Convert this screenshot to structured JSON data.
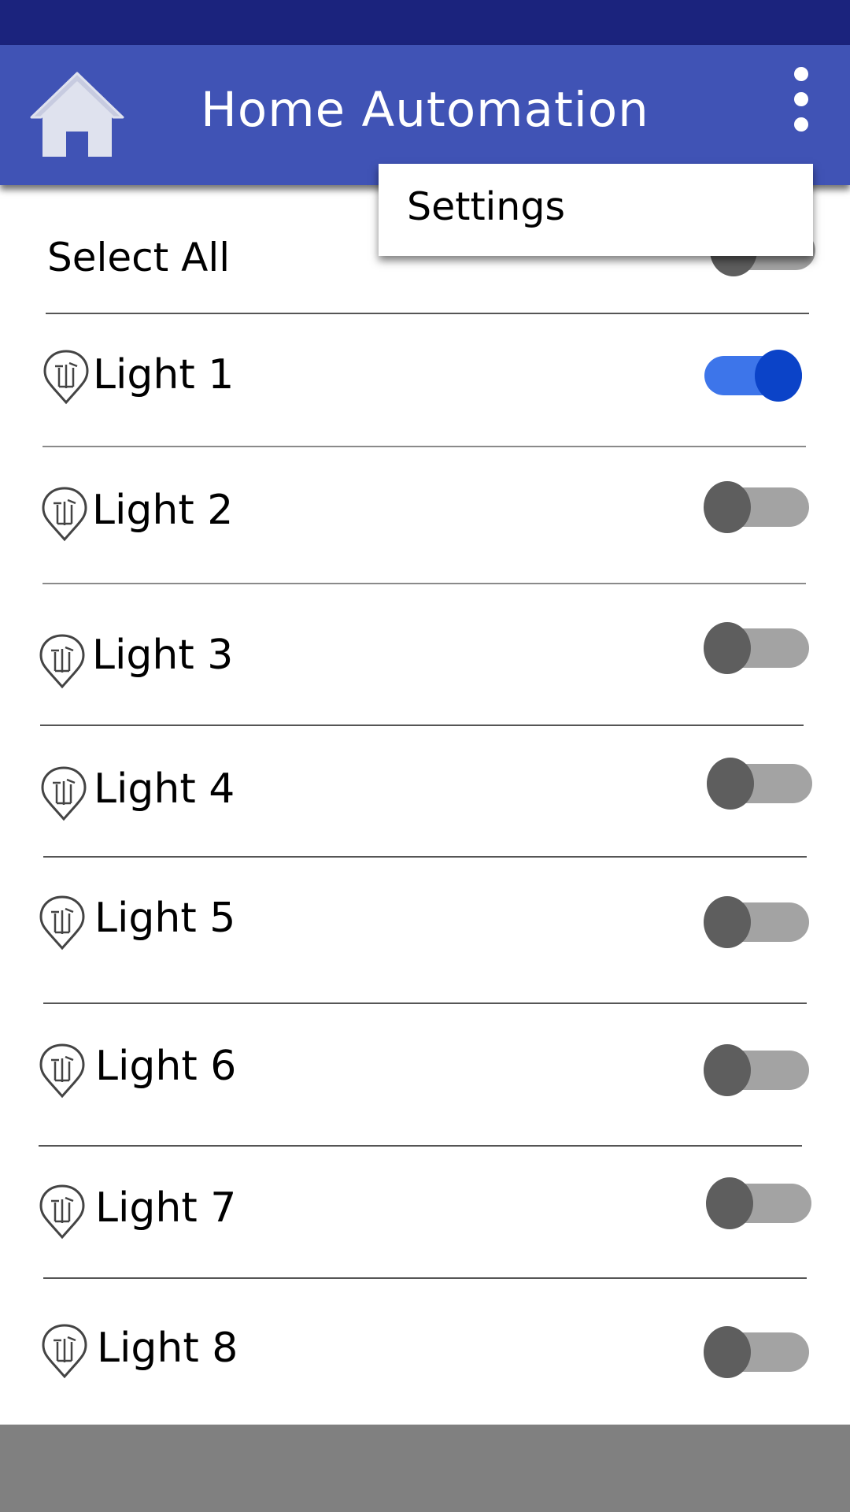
{
  "app_bar": {
    "title": "Home Automation",
    "home_icon": "home-icon",
    "overflow_icon": "more-vert-icon",
    "color": "#4053b5",
    "status_bar_color": "#1b237d"
  },
  "overflow_menu": {
    "items": [
      {
        "label": "Settings"
      }
    ]
  },
  "select_all": {
    "label": "Select All",
    "state": "off"
  },
  "lights": [
    {
      "label": "Light 1",
      "icon": "lightbulb-icon",
      "state": "on"
    },
    {
      "label": "Light 2",
      "icon": "lightbulb-icon",
      "state": "off"
    },
    {
      "label": "Light 3",
      "icon": "lightbulb-icon",
      "state": "off"
    },
    {
      "label": "Light 4",
      "icon": "lightbulb-icon",
      "state": "off"
    },
    {
      "label": "Light 5",
      "icon": "lightbulb-icon",
      "state": "off"
    },
    {
      "label": "Light 6",
      "icon": "lightbulb-icon",
      "state": "off"
    },
    {
      "label": "Light 7",
      "icon": "lightbulb-icon",
      "state": "off"
    },
    {
      "label": "Light 8",
      "icon": "lightbulb-icon",
      "state": "off"
    }
  ],
  "colors": {
    "toggle_on": "#0b43c8",
    "toggle_off": "#5e5e5e"
  }
}
